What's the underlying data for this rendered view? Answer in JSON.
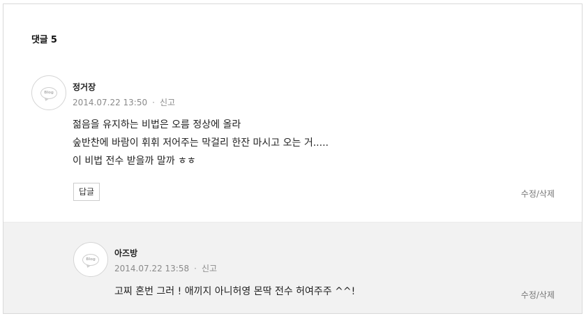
{
  "comments_header": {
    "title": "댓글 5"
  },
  "comments": [
    {
      "avatar_label": "Blog",
      "author": "정거장",
      "date": "2014.07.22 13:50",
      "separator": "·",
      "report_label": "신고",
      "lines": [
        "젊음을 유지하는 비법은 오름 정상에 올라",
        "숲반찬에 바람이 휘휘 저어주는 막걸리 한잔 마시고 오는 거.....",
        "이 비법 전수 받을까 말까 ㅎㅎ"
      ],
      "reply_label": "답글",
      "edit_delete_label": "수정/삭제"
    },
    {
      "avatar_label": "Blog",
      "author": "아즈방",
      "date": "2014.07.22 13:58",
      "separator": "·",
      "report_label": "신고",
      "lines": [
        "고찌 혼번 그러 ! 애끼지 아니허영 몬딱 전수 허여주주 ^^!"
      ],
      "edit_delete_label": "수정/삭제"
    }
  ]
}
